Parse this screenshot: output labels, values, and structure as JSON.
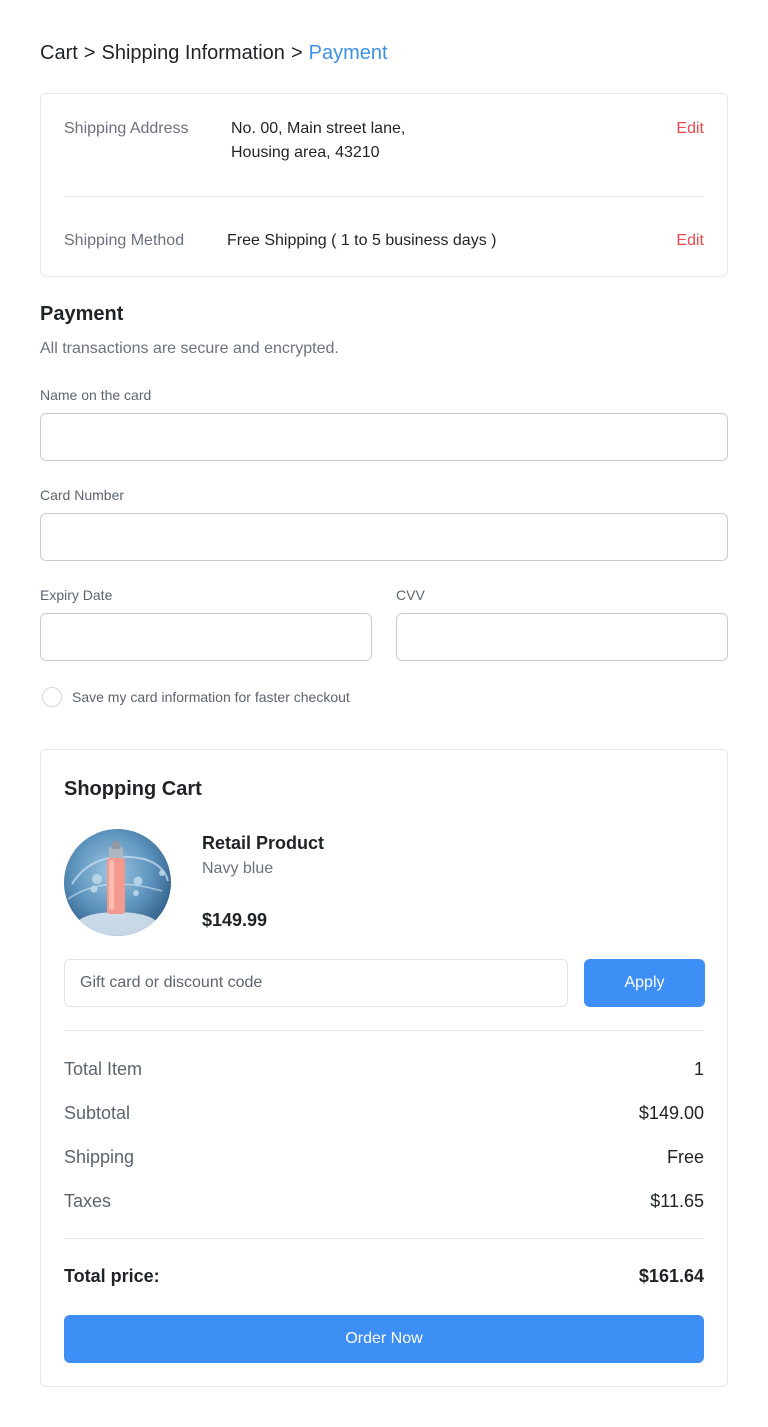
{
  "breadcrumb": {
    "items": [
      "Cart",
      "Shipping Information",
      "Payment"
    ],
    "separator": ">",
    "active_color": "#3d8fe8"
  },
  "shipping": {
    "address_label": "Shipping Address",
    "address_line1": "No. 00, Main street lane,",
    "address_line2": "Housing area, 43210",
    "method_label": "Shipping Method",
    "method_value": "Free Shipping ( 1 to 5 business days )",
    "edit_label": "Edit"
  },
  "payment": {
    "title": "Payment",
    "subtitle": "All transactions are secure and encrypted.",
    "name_label": "Name on the card",
    "name_value": "",
    "card_number_label": "Card Number",
    "card_number_value": "",
    "expiry_label": "Expiry Date",
    "expiry_value": "",
    "cvv_label": "CVV",
    "cvv_value": "",
    "save_card_label": "Save my card information for faster checkout",
    "save_card_checked": false
  },
  "cart": {
    "title": "Shopping Cart",
    "product": {
      "name": "Retail Product",
      "variant": "Navy blue",
      "price": "$149.99",
      "image_icon": "product-bottle-image"
    },
    "discount_placeholder": "Gift card or discount code",
    "apply_label": "Apply",
    "summary": [
      {
        "label": "Total Item",
        "value": "1"
      },
      {
        "label": "Subtotal",
        "value": "$149.00"
      },
      {
        "label": "Shipping",
        "value": "Free"
      },
      {
        "label": "Taxes",
        "value": "$11.65"
      }
    ],
    "total_label": "Total price:",
    "total_value": "$161.64",
    "order_label": "Order Now",
    "button_color": "#3d8ff5"
  }
}
